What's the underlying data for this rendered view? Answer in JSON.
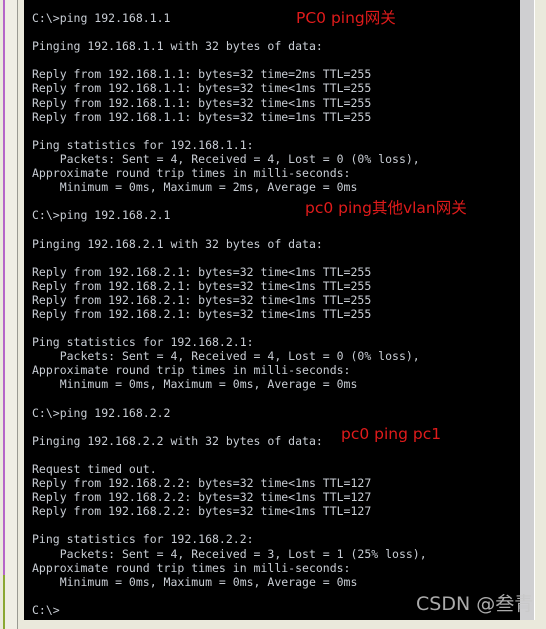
{
  "terminal": {
    "prompt_symbol": "C:\\>",
    "lines": [
      "C:\\>ping 192.168.1.1",
      "",
      "Pinging 192.168.1.1 with 32 bytes of data:",
      "",
      "Reply from 192.168.1.1: bytes=32 time=2ms TTL=255",
      "Reply from 192.168.1.1: bytes=32 time<1ms TTL=255",
      "Reply from 192.168.1.1: bytes=32 time<1ms TTL=255",
      "Reply from 192.168.1.1: bytes=32 time=1ms TTL=255",
      "",
      "Ping statistics for 192.168.1.1:",
      "    Packets: Sent = 4, Received = 4, Lost = 0 (0% loss),",
      "Approximate round trip times in milli-seconds:",
      "    Minimum = 0ms, Maximum = 2ms, Average = 0ms",
      "",
      "C:\\>ping 192.168.2.1",
      "",
      "Pinging 192.168.2.1 with 32 bytes of data:",
      "",
      "Reply from 192.168.2.1: bytes=32 time<1ms TTL=255",
      "Reply from 192.168.2.1: bytes=32 time<1ms TTL=255",
      "Reply from 192.168.2.1: bytes=32 time<1ms TTL=255",
      "Reply from 192.168.2.1: bytes=32 time<1ms TTL=255",
      "",
      "Ping statistics for 192.168.2.1:",
      "    Packets: Sent = 4, Received = 4, Lost = 0 (0% loss),",
      "Approximate round trip times in milli-seconds:",
      "    Minimum = 0ms, Maximum = 0ms, Average = 0ms",
      "",
      "C:\\>ping 192.168.2.2",
      "",
      "Pinging 192.168.2.2 with 32 bytes of data:",
      "",
      "Request timed out.",
      "Reply from 192.168.2.2: bytes=32 time<1ms TTL=127",
      "Reply from 192.168.2.2: bytes=32 time<1ms TTL=127",
      "Reply from 192.168.2.2: bytes=32 time<1ms TTL=127",
      "",
      "Ping statistics for 192.168.2.2:",
      "    Packets: Sent = 4, Received = 3, Lost = 1 (25% loss),",
      "Approximate round trip times in milli-seconds:",
      "    Minimum = 0ms, Maximum = 0ms, Average = 0ms",
      "",
      "C:\\>"
    ]
  },
  "annotations": [
    {
      "text": "PC0 ping网关",
      "color": "#e01b1b"
    },
    {
      "text": "pc0 ping其他vlan网关",
      "color": "#e01b1b"
    },
    {
      "text": "pc0 ping pc1",
      "color": "#e01b1b"
    }
  ],
  "watermark": {
    "text": "CSDN @叁青",
    "color": "#c9c9c9"
  },
  "colors": {
    "terminal_background": "#000000",
    "terminal_text": "#c8cdd4",
    "page_background": "#eae9dc",
    "accent_rule": "#b566c8",
    "accent_rule_alt": "#8aa832",
    "scrollbar": "#cfcfd1",
    "annotation_red": "#e01b1b"
  }
}
